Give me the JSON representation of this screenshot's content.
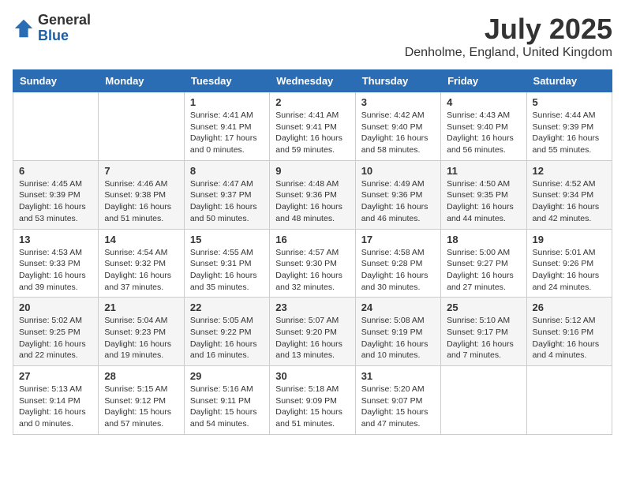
{
  "header": {
    "logo_general": "General",
    "logo_blue": "Blue",
    "title": "July 2025",
    "subtitle": "Denholme, England, United Kingdom"
  },
  "calendar": {
    "weekdays": [
      "Sunday",
      "Monday",
      "Tuesday",
      "Wednesday",
      "Thursday",
      "Friday",
      "Saturday"
    ],
    "weeks": [
      [
        {
          "day": "",
          "info": ""
        },
        {
          "day": "",
          "info": ""
        },
        {
          "day": "1",
          "info": "Sunrise: 4:41 AM\nSunset: 9:41 PM\nDaylight: 17 hours and 0 minutes."
        },
        {
          "day": "2",
          "info": "Sunrise: 4:41 AM\nSunset: 9:41 PM\nDaylight: 16 hours and 59 minutes."
        },
        {
          "day": "3",
          "info": "Sunrise: 4:42 AM\nSunset: 9:40 PM\nDaylight: 16 hours and 58 minutes."
        },
        {
          "day": "4",
          "info": "Sunrise: 4:43 AM\nSunset: 9:40 PM\nDaylight: 16 hours and 56 minutes."
        },
        {
          "day": "5",
          "info": "Sunrise: 4:44 AM\nSunset: 9:39 PM\nDaylight: 16 hours and 55 minutes."
        }
      ],
      [
        {
          "day": "6",
          "info": "Sunrise: 4:45 AM\nSunset: 9:39 PM\nDaylight: 16 hours and 53 minutes."
        },
        {
          "day": "7",
          "info": "Sunrise: 4:46 AM\nSunset: 9:38 PM\nDaylight: 16 hours and 51 minutes."
        },
        {
          "day": "8",
          "info": "Sunrise: 4:47 AM\nSunset: 9:37 PM\nDaylight: 16 hours and 50 minutes."
        },
        {
          "day": "9",
          "info": "Sunrise: 4:48 AM\nSunset: 9:36 PM\nDaylight: 16 hours and 48 minutes."
        },
        {
          "day": "10",
          "info": "Sunrise: 4:49 AM\nSunset: 9:36 PM\nDaylight: 16 hours and 46 minutes."
        },
        {
          "day": "11",
          "info": "Sunrise: 4:50 AM\nSunset: 9:35 PM\nDaylight: 16 hours and 44 minutes."
        },
        {
          "day": "12",
          "info": "Sunrise: 4:52 AM\nSunset: 9:34 PM\nDaylight: 16 hours and 42 minutes."
        }
      ],
      [
        {
          "day": "13",
          "info": "Sunrise: 4:53 AM\nSunset: 9:33 PM\nDaylight: 16 hours and 39 minutes."
        },
        {
          "day": "14",
          "info": "Sunrise: 4:54 AM\nSunset: 9:32 PM\nDaylight: 16 hours and 37 minutes."
        },
        {
          "day": "15",
          "info": "Sunrise: 4:55 AM\nSunset: 9:31 PM\nDaylight: 16 hours and 35 minutes."
        },
        {
          "day": "16",
          "info": "Sunrise: 4:57 AM\nSunset: 9:30 PM\nDaylight: 16 hours and 32 minutes."
        },
        {
          "day": "17",
          "info": "Sunrise: 4:58 AM\nSunset: 9:28 PM\nDaylight: 16 hours and 30 minutes."
        },
        {
          "day": "18",
          "info": "Sunrise: 5:00 AM\nSunset: 9:27 PM\nDaylight: 16 hours and 27 minutes."
        },
        {
          "day": "19",
          "info": "Sunrise: 5:01 AM\nSunset: 9:26 PM\nDaylight: 16 hours and 24 minutes."
        }
      ],
      [
        {
          "day": "20",
          "info": "Sunrise: 5:02 AM\nSunset: 9:25 PM\nDaylight: 16 hours and 22 minutes."
        },
        {
          "day": "21",
          "info": "Sunrise: 5:04 AM\nSunset: 9:23 PM\nDaylight: 16 hours and 19 minutes."
        },
        {
          "day": "22",
          "info": "Sunrise: 5:05 AM\nSunset: 9:22 PM\nDaylight: 16 hours and 16 minutes."
        },
        {
          "day": "23",
          "info": "Sunrise: 5:07 AM\nSunset: 9:20 PM\nDaylight: 16 hours and 13 minutes."
        },
        {
          "day": "24",
          "info": "Sunrise: 5:08 AM\nSunset: 9:19 PM\nDaylight: 16 hours and 10 minutes."
        },
        {
          "day": "25",
          "info": "Sunrise: 5:10 AM\nSunset: 9:17 PM\nDaylight: 16 hours and 7 minutes."
        },
        {
          "day": "26",
          "info": "Sunrise: 5:12 AM\nSunset: 9:16 PM\nDaylight: 16 hours and 4 minutes."
        }
      ],
      [
        {
          "day": "27",
          "info": "Sunrise: 5:13 AM\nSunset: 9:14 PM\nDaylight: 16 hours and 0 minutes."
        },
        {
          "day": "28",
          "info": "Sunrise: 5:15 AM\nSunset: 9:12 PM\nDaylight: 15 hours and 57 minutes."
        },
        {
          "day": "29",
          "info": "Sunrise: 5:16 AM\nSunset: 9:11 PM\nDaylight: 15 hours and 54 minutes."
        },
        {
          "day": "30",
          "info": "Sunrise: 5:18 AM\nSunset: 9:09 PM\nDaylight: 15 hours and 51 minutes."
        },
        {
          "day": "31",
          "info": "Sunrise: 5:20 AM\nSunset: 9:07 PM\nDaylight: 15 hours and 47 minutes."
        },
        {
          "day": "",
          "info": ""
        },
        {
          "day": "",
          "info": ""
        }
      ]
    ]
  }
}
